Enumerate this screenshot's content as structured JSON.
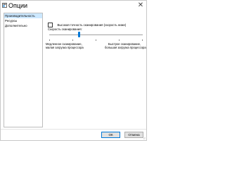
{
  "window": {
    "title": "Опции",
    "close_glyph": "✕",
    "app_icon": "options-window-icon",
    "accent_color": "#0078d7"
  },
  "sidebar": {
    "items": [
      {
        "label": "Производительность",
        "selected": true
      },
      {
        "label": "Ресурсы",
        "selected": false
      },
      {
        "label": "Дополнительно",
        "selected": false
      }
    ]
  },
  "performance": {
    "high_accuracy_checkbox_label": "Высокая точность сканирования (скорость ниже)",
    "high_accuracy_checked": false,
    "scan_speed_label": "Скорость сканирования:",
    "scan_speed_level": 0.32,
    "slow_caption_line1": "Медленное сканирование,",
    "slow_caption_line2": "малая загрузка процессора",
    "fast_caption_line1": "Быстрое сканирование,",
    "fast_caption_line2": "большая загрузка процессора"
  },
  "footer": {
    "ok_label": "ОК",
    "cancel_label": "Отмена"
  }
}
